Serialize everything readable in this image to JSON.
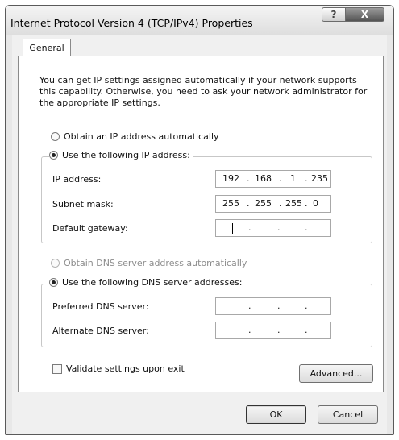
{
  "window": {
    "title": "Internet Protocol Version 4 (TCP/IPv4) Properties",
    "help_label": "?",
    "close_label": "X"
  },
  "tabs": [
    {
      "label": "General"
    }
  ],
  "description": "You can get IP settings assigned automatically if your network supports this capability. Otherwise, you need to ask your network administrator for the appropriate IP settings.",
  "ip": {
    "auto_label": "Obtain an IP address automatically",
    "manual_label": "Use the following IP address:",
    "selected": "manual",
    "fields": {
      "ip_address": {
        "label": "IP address:",
        "octets": [
          "192",
          "168",
          "1",
          "235"
        ]
      },
      "subnet_mask": {
        "label": "Subnet mask:",
        "octets": [
          "255",
          "255",
          "255",
          "0"
        ]
      },
      "default_gateway": {
        "label": "Default gateway:",
        "octets": [
          "",
          "",
          "",
          ""
        ]
      }
    }
  },
  "dns": {
    "auto_label": "Obtain DNS server address automatically",
    "manual_label": "Use the following DNS server addresses:",
    "selected": "manual",
    "fields": {
      "preferred": {
        "label": "Preferred DNS server:",
        "octets": [
          "",
          "",
          "",
          ""
        ]
      },
      "alternate": {
        "label": "Alternate DNS server:",
        "octets": [
          "",
          "",
          "",
          ""
        ]
      }
    }
  },
  "validate": {
    "label": "Validate settings upon exit",
    "checked": false
  },
  "buttons": {
    "advanced": "Advanced...",
    "ok": "OK",
    "cancel": "Cancel"
  },
  "separator": "."
}
